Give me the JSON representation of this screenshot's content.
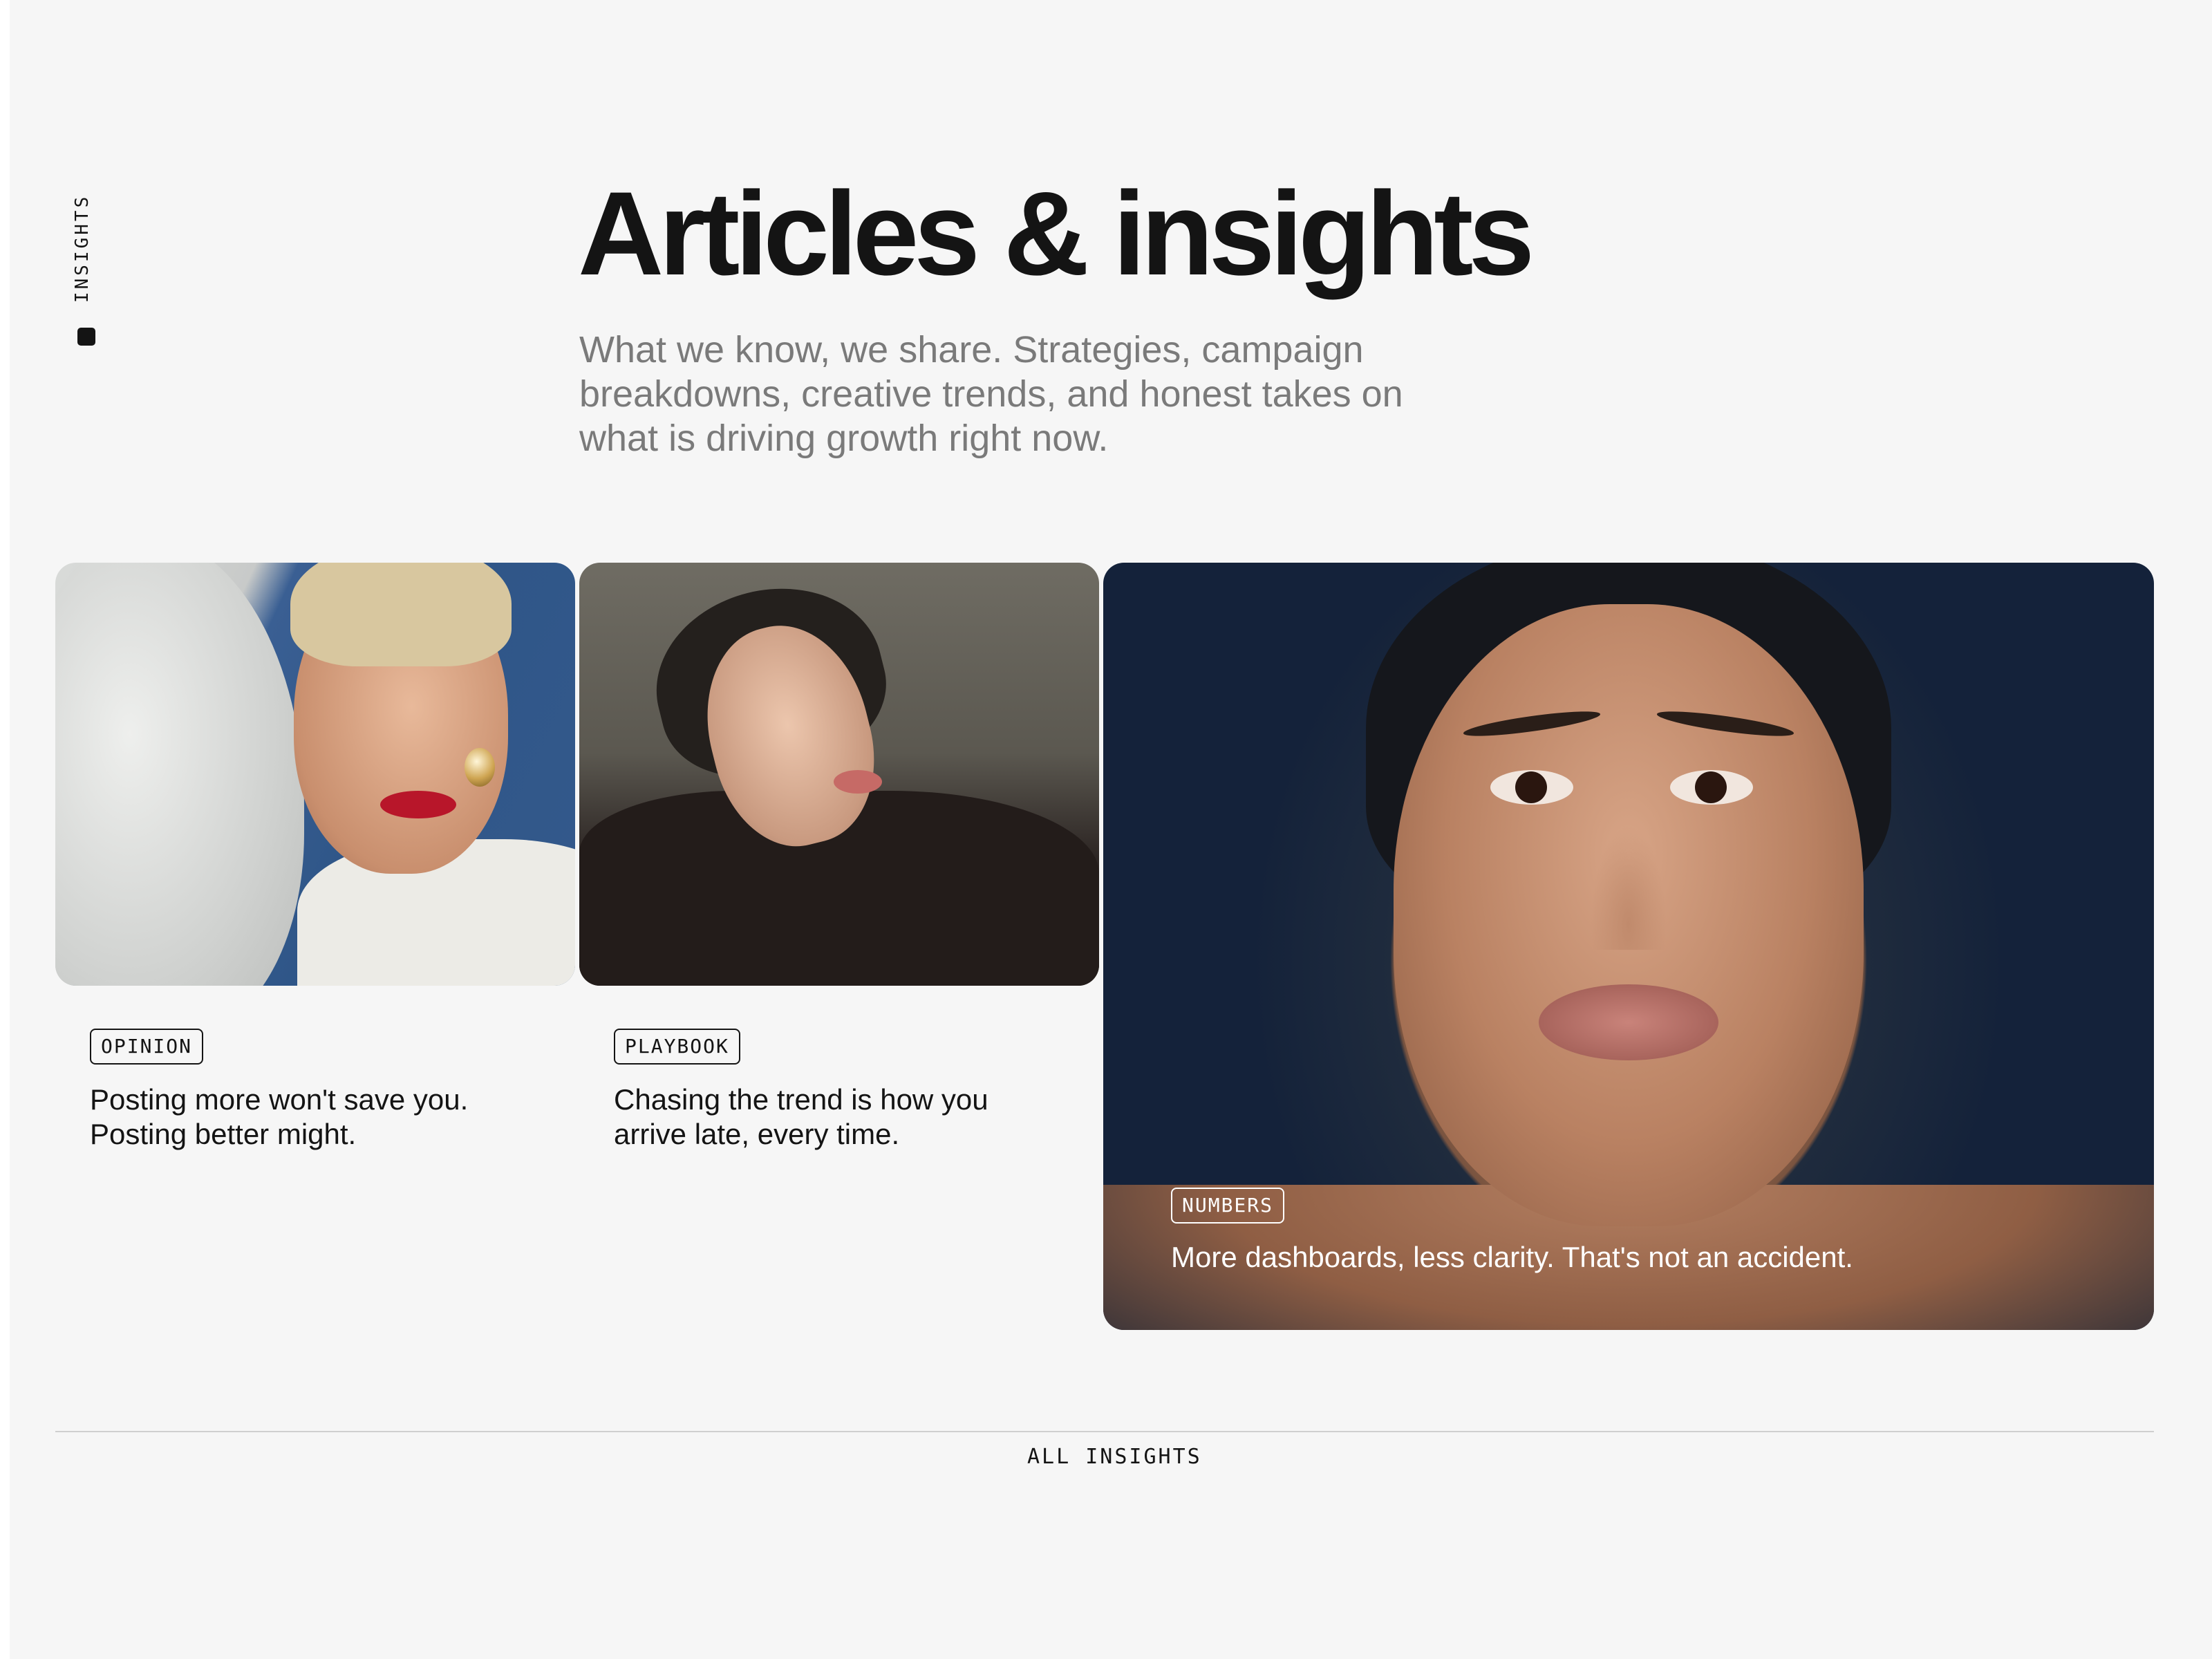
{
  "section": {
    "side_label": "INSIGHTS",
    "title": "Articles & insights",
    "intro": "What we know, we share. Strategies, campaign breakdowns, creative trends, and honest takes on what is driving growth right now."
  },
  "cards": [
    {
      "tag": "OPINION",
      "text": "Posting more won't save you. Posting better might."
    },
    {
      "tag": "PLAYBOOK",
      "text": "Chasing the trend is how you arrive late, every time."
    },
    {
      "tag": "NUMBERS",
      "text": "More dashboards, less clarity. That's not an accident."
    }
  ],
  "footer": {
    "link": "ALL INSIGHTS"
  },
  "colors": {
    "background": "#f6f6f6",
    "text": "#141414",
    "muted": "#7a7a7a"
  }
}
